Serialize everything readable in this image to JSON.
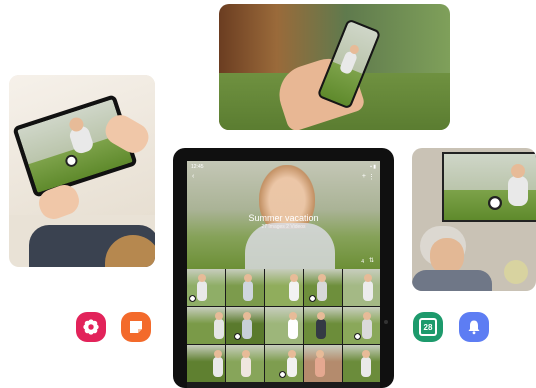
{
  "tablet": {
    "status_time": "12:45",
    "status_icons": "▪ ▮",
    "album_title": "Summer vacation",
    "album_subtitle": "27 Images 2 Videos",
    "back_icon": "back-arrow-icon",
    "add_icon": "plus-icon",
    "more_icon": "more-vertical-icon",
    "count_label": "4"
  },
  "apps": [
    {
      "name": "gallery-app-icon",
      "color": "#e2235a"
    },
    {
      "name": "notes-app-icon",
      "color": "#f36a2b"
    },
    {
      "name": "calendar-app-icon",
      "color": "#1d9a6c",
      "label": "28"
    },
    {
      "name": "reminder-app-icon",
      "color": "#5d7df3"
    }
  ],
  "thumbnails": [
    {
      "bg": "#8fae67",
      "kid": "#e9e9e9"
    },
    {
      "bg": "#7c9b4c",
      "kid": "#cfd6de"
    },
    {
      "bg": "#90ad5c",
      "kid": "#f2f2f2"
    },
    {
      "bg": "#6e8f3c",
      "kid": "#d8d8d8"
    },
    {
      "bg": "#a4b985",
      "kid": "#ececec"
    },
    {
      "bg": "#7a9a48",
      "kid": "#e5e5e5"
    },
    {
      "bg": "#5a7a2d",
      "kid": "#c8d0d8"
    },
    {
      "bg": "#9db67a",
      "kid": "#ffffff"
    },
    {
      "bg": "#6c8d3a",
      "kid": "#343a44"
    },
    {
      "bg": "#8aa85a",
      "kid": "#dadada"
    },
    {
      "bg": "#5f8030",
      "kid": "#e9e9e9"
    },
    {
      "bg": "#87a55a",
      "kid": "#efe6df"
    },
    {
      "bg": "#7e9d4f",
      "kid": "#f1f1f1"
    },
    {
      "bg": "#b48b6d",
      "kid": "#e5a890"
    },
    {
      "bg": "#6b8c3b",
      "kid": "#e9e9e9"
    }
  ]
}
